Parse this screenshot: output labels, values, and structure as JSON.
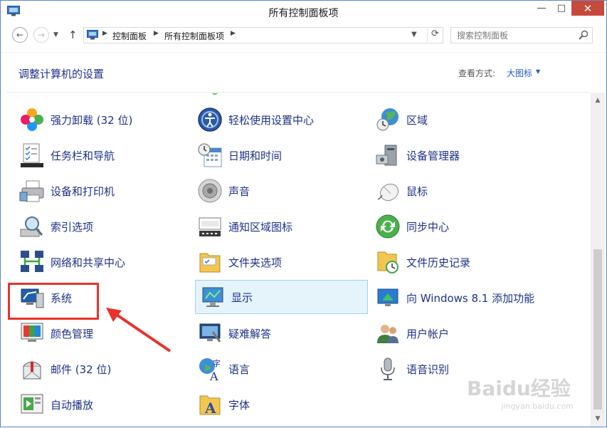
{
  "window": {
    "title": "所有控制面板项",
    "controls": {
      "minimize": "—",
      "maximize": "□",
      "close": "✕"
    }
  },
  "address": {
    "breadcrumbs": [
      "控制面板",
      "所有控制面板项"
    ],
    "search_placeholder": "搜索控制面板"
  },
  "header": {
    "title": "调整计算机的设置",
    "view_by_label": "查看方式:",
    "view_by_value": "大图标"
  },
  "items": [
    {
      "label": "强力卸载 (32 位)",
      "icon": "uninstall-flower-icon"
    },
    {
      "label": "轻松使用设置中心",
      "icon": "ease-of-access-icon"
    },
    {
      "label": "区域",
      "icon": "region-globe-icon"
    },
    {
      "label": "任务栏和导航",
      "icon": "taskbar-icon"
    },
    {
      "label": "日期和时间",
      "icon": "date-time-icon"
    },
    {
      "label": "设备管理器",
      "icon": "device-manager-icon"
    },
    {
      "label": "设备和打印机",
      "icon": "printer-icon"
    },
    {
      "label": "声音",
      "icon": "speaker-icon"
    },
    {
      "label": "鼠标",
      "icon": "mouse-icon"
    },
    {
      "label": "索引选项",
      "icon": "indexing-icon"
    },
    {
      "label": "通知区域图标",
      "icon": "notification-area-icon"
    },
    {
      "label": "同步中心",
      "icon": "sync-center-icon"
    },
    {
      "label": "网络和共享中心",
      "icon": "network-icon"
    },
    {
      "label": "文件夹选项",
      "icon": "folder-options-icon"
    },
    {
      "label": "文件历史记录",
      "icon": "file-history-icon"
    },
    {
      "label": "系统",
      "icon": "system-icon"
    },
    {
      "label": "显示",
      "icon": "display-icon"
    },
    {
      "label": "向 Windows 8.1 添加功能",
      "icon": "add-features-icon"
    },
    {
      "label": "颜色管理",
      "icon": "color-management-icon"
    },
    {
      "label": "疑难解答",
      "icon": "troubleshooting-icon"
    },
    {
      "label": "用户帐户",
      "icon": "user-accounts-icon"
    },
    {
      "label": "邮件 (32 位)",
      "icon": "mail-icon"
    },
    {
      "label": "语言",
      "icon": "language-icon"
    },
    {
      "label": "语音识别",
      "icon": "microphone-icon"
    },
    {
      "label": "自动播放",
      "icon": "autoplay-icon"
    },
    {
      "label": "字体",
      "icon": "fonts-icon"
    }
  ],
  "selected_item": "显示",
  "annotation": {
    "highlighted_item": "系统",
    "color": "#e8322b"
  },
  "watermark": {
    "text": "Baidu经验",
    "subtext": "jingyan.baidu.com"
  },
  "colors": {
    "link": "#1e3287",
    "selection": "#e5f3fb",
    "close_button": "#c7493b"
  }
}
